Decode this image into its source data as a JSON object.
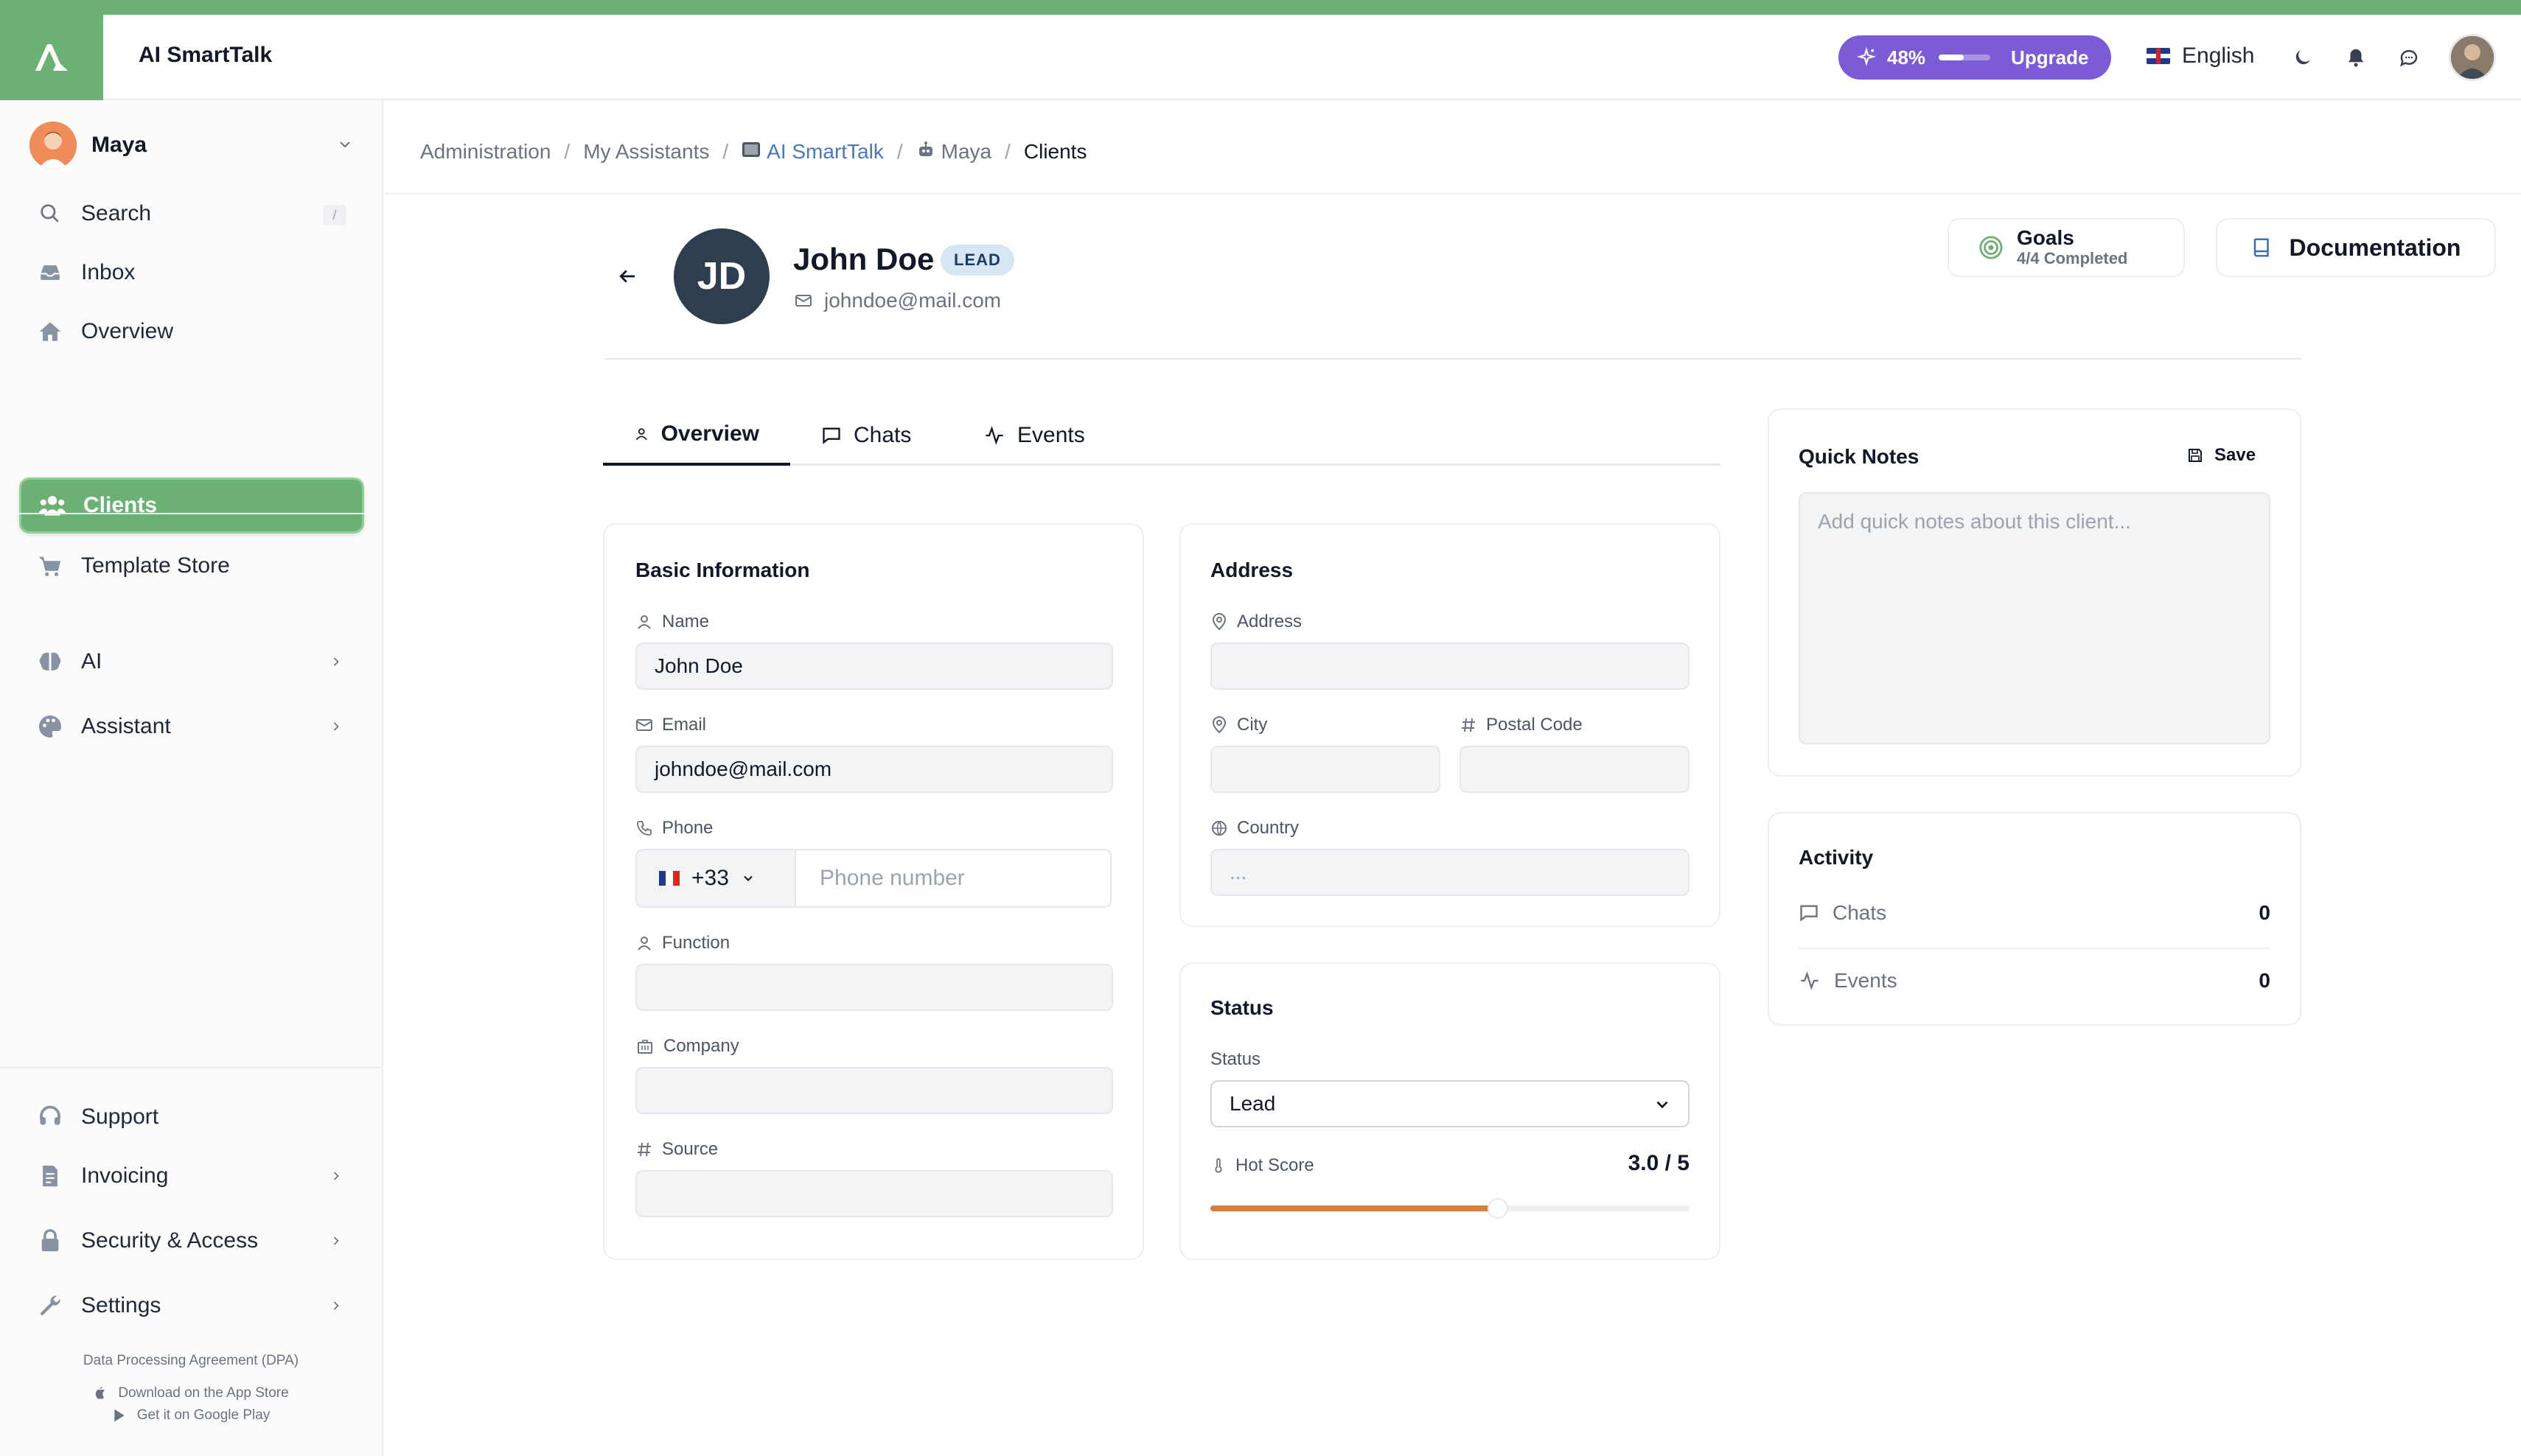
{
  "app": {
    "title": "AI SmartTalk"
  },
  "header": {
    "upgrade": {
      "percent_label": "48%",
      "percent": 48,
      "label": "Upgrade"
    },
    "language": "English",
    "icons": [
      "moon-icon",
      "bell-icon",
      "chat-icon",
      "user-avatar"
    ]
  },
  "sidebar": {
    "profile_name": "Maya",
    "search": {
      "label": "Search",
      "shortcut": "/"
    },
    "items": [
      {
        "label": "Inbox",
        "icon": "inbox-icon"
      },
      {
        "label": "Overview",
        "icon": "home-icon"
      },
      {
        "label": "Clients",
        "icon": "users-icon",
        "active": true
      },
      {
        "label": "Template Store",
        "icon": "cart-icon"
      }
    ],
    "groups": [
      {
        "label": "AI",
        "icon": "brain-icon"
      },
      {
        "label": "Assistant",
        "icon": "palette-icon"
      }
    ],
    "bottom_items": [
      {
        "label": "Support",
        "icon": "headset-icon"
      },
      {
        "label": "Invoicing",
        "icon": "invoice-icon"
      },
      {
        "label": "Security & Access",
        "icon": "lock-icon"
      },
      {
        "label": "Settings",
        "icon": "wrench-icon"
      }
    ],
    "footer": {
      "dpa": "Data Processing Agreement (DPA)",
      "app_store": "Download on the App Store",
      "google_play": "Get it on Google Play"
    }
  },
  "breadcrumb": {
    "items": [
      "Administration",
      "My Assistants",
      "AI SmartTalk",
      "Maya",
      "Clients"
    ]
  },
  "client": {
    "initials": "JD",
    "name": "John Doe",
    "badge": "LEAD",
    "email": "johndoe@mail.com"
  },
  "actions": {
    "goals_title": "Goals",
    "goals_sub": "4/4 Completed",
    "documentation": "Documentation"
  },
  "tabs": [
    {
      "label": "Overview",
      "active": true
    },
    {
      "label": "Chats"
    },
    {
      "label": "Events"
    }
  ],
  "basic_info": {
    "title": "Basic Information",
    "name_label": "Name",
    "name_value": "John Doe",
    "email_label": "Email",
    "email_value": "johndoe@mail.com",
    "phone_label": "Phone",
    "phone_prefix": "+33",
    "phone_placeholder": "Phone number",
    "function_label": "Function",
    "company_label": "Company",
    "source_label": "Source"
  },
  "address": {
    "title": "Address",
    "address_label": "Address",
    "city_label": "City",
    "postal_label": "Postal Code",
    "country_label": "Country",
    "country_placeholder": "..."
  },
  "status": {
    "title": "Status",
    "status_label": "Status",
    "status_value": "Lead",
    "hot_score_label": "Hot Score",
    "hot_score_value": "3.0 / 5",
    "hot_score": 3.0,
    "hot_score_max": 5
  },
  "notes": {
    "title": "Quick Notes",
    "save_label": "Save",
    "placeholder": "Add quick notes about this client..."
  },
  "activity": {
    "title": "Activity",
    "rows": [
      {
        "label": "Chats",
        "value": "0",
        "icon": "chat-icon"
      },
      {
        "label": "Events",
        "value": "0",
        "icon": "pulse-icon"
      }
    ]
  },
  "colors": {
    "accent": "#6cb174",
    "upgrade": "#7c5bd6",
    "badge_bg": "#d6e6f5",
    "avatar_dark": "#2f3e4e",
    "slider": "#d97e3c"
  }
}
